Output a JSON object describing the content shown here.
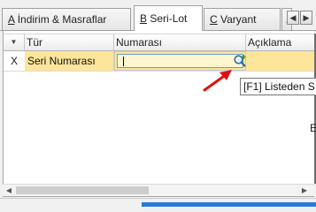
{
  "tabs": [
    {
      "hotkey": "A",
      "label": "İndirim & Masraflar",
      "active": false
    },
    {
      "hotkey": "B",
      "label": "Seri-Lot",
      "active": true
    },
    {
      "hotkey": "C",
      "label": "Varyant",
      "active": false
    },
    {
      "hotkey": "",
      "label": "…",
      "active": false
    }
  ],
  "tab_nav": {
    "left_icon": "chevron-left-icon",
    "right_icon": "chevron-right-icon"
  },
  "grid": {
    "header_indicator": "▼",
    "columns": [
      "Tür",
      "Numarası",
      "Açıklama"
    ],
    "rows": [
      {
        "indicator": "X",
        "tur": "Seri Numarası",
        "numarasi": "",
        "aciklama": ""
      }
    ],
    "row_color": "#fde59a"
  },
  "lookup_icon": "search-add-icon",
  "tooltip": {
    "text": "[F1] Listeden S"
  },
  "right_edge_text": "E",
  "colors": {
    "accent": "#2a78d6",
    "annotation": "#e01010"
  }
}
